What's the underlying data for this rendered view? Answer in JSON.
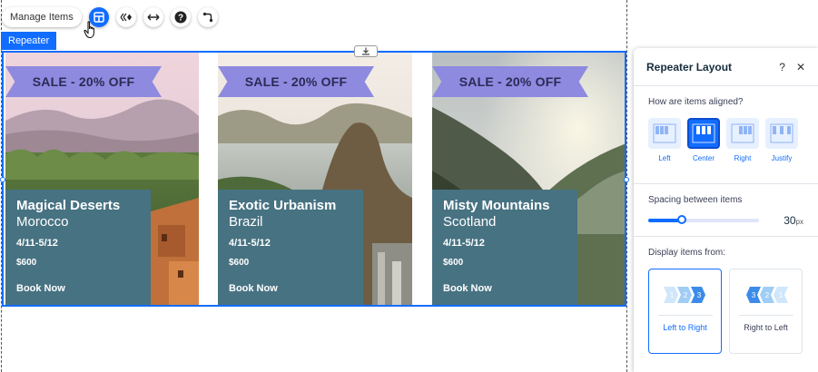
{
  "toolbar": {
    "manage_items": "Manage Items",
    "icons": [
      "layout-icon",
      "animation-icon",
      "stretch-icon",
      "help-icon",
      "connect-data-icon"
    ]
  },
  "repeater": {
    "tag": "Repeater",
    "cards": [
      {
        "banner": "SALE - 20% OFF",
        "title": "Magical Deserts",
        "subtitle": "Morocco",
        "dates": "4/11-5/12",
        "price": "$600",
        "cta": "Book Now"
      },
      {
        "banner": "SALE - 20% OFF",
        "title": "Exotic Urbanism",
        "subtitle": "Brazil",
        "dates": "4/11-5/12",
        "price": "$600",
        "cta": "Book Now"
      },
      {
        "banner": "SALE - 20% OFF",
        "title": "Misty Mountains",
        "subtitle": "Scotland",
        "dates": "4/11-5/12",
        "price": "$600",
        "cta": "Book Now"
      }
    ]
  },
  "panel": {
    "title": "Repeater Layout",
    "help": "?",
    "close": "✕",
    "alignment_label": "How are items aligned?",
    "alignment_options": [
      "Left",
      "Center",
      "Right",
      "Justify"
    ],
    "alignment_selected": "Center",
    "spacing_label": "Spacing between items",
    "spacing_value": "30",
    "spacing_unit": "px",
    "spacing_fraction": 0.3,
    "direction_label": "Display items from:",
    "direction_options": [
      "Left to Right",
      "Right to Left"
    ],
    "direction_selected": "Left to Right"
  },
  "colors": {
    "accent": "#116dff",
    "banner": "#8e8ae0",
    "banner_text": "#2b2b55",
    "info_box": "#477282"
  }
}
